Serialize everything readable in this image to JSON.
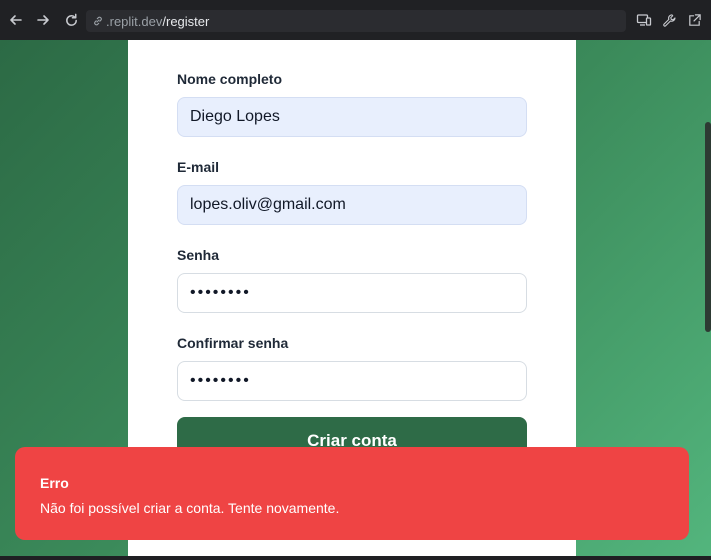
{
  "browser": {
    "url_host": ".replit.dev",
    "url_path": "/register",
    "icons": {
      "back": "arrow-left-icon",
      "forward": "arrow-right-icon",
      "reload": "reload-icon",
      "secure": "link-icon",
      "devices": "devices-icon",
      "tools": "wrench-icon",
      "open_external": "external-link-icon"
    }
  },
  "form": {
    "fields": [
      {
        "label": "Nome completo",
        "value": "Diego Lopes"
      },
      {
        "label": "E-mail",
        "value": "lopes.oliv@gmail.com"
      },
      {
        "label": "Senha",
        "value": "••••••••"
      },
      {
        "label": "Confirmar senha",
        "value": "••••••••"
      }
    ],
    "submit_label": "Criar conta"
  },
  "toast": {
    "title": "Erro",
    "message": "Não foi possível criar a conta. Tente novamente."
  },
  "colors": {
    "toast_bg": "#ef4444",
    "button_bg": "#2e6b47",
    "autofill_bg": "#e8effd"
  }
}
